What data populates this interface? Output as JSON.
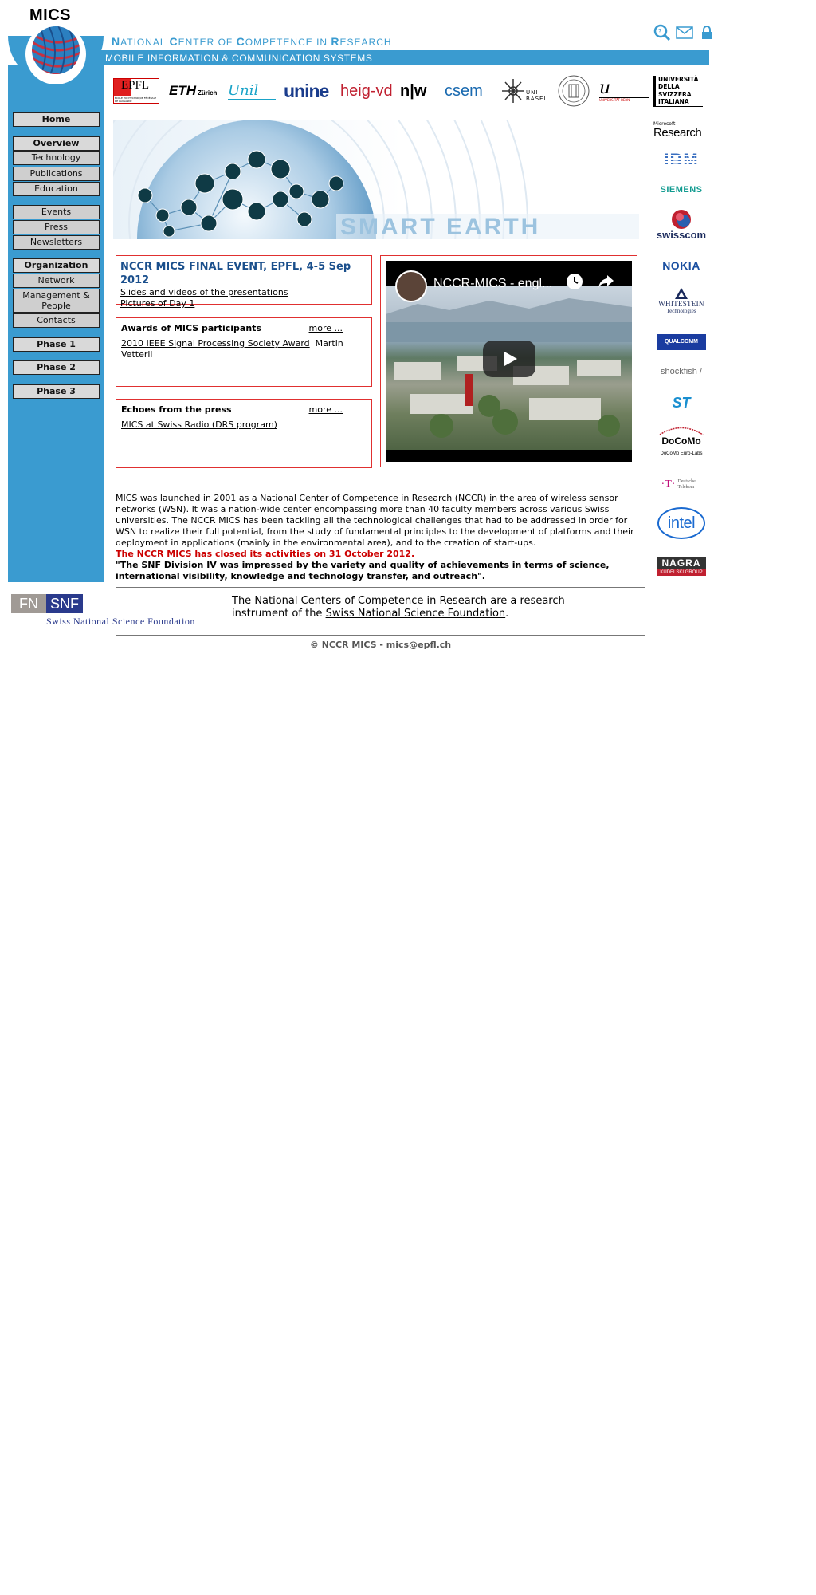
{
  "header": {
    "logo_text": "MICS",
    "nccr_title_parts": [
      {
        "cap": "N",
        "rest": "ATIONAL "
      },
      {
        "cap": "C",
        "rest": "ENTER OF "
      },
      {
        "cap": "C",
        "rest": "OMPETENCE IN "
      },
      {
        "cap": "R",
        "rest": "ESEARCH"
      }
    ],
    "subtitle": "MOBILE INFORMATION & COMMUNICATION SYSTEMS",
    "icons": [
      "search-icon",
      "mail-icon",
      "lock-icon"
    ]
  },
  "sidebar": {
    "items": [
      {
        "label": "Home",
        "bold": true
      },
      {
        "label": "Overview",
        "bold": true
      },
      {
        "label": "Technology"
      },
      {
        "label": "Publications"
      },
      {
        "label": "Education"
      },
      {
        "label": "Events"
      },
      {
        "label": "Press"
      },
      {
        "label": "Newsletters"
      },
      {
        "label": "Organization",
        "bold": true
      },
      {
        "label": "Network"
      },
      {
        "label": "Management & People"
      },
      {
        "label": "Contacts"
      },
      {
        "label": "Phase 1",
        "bold": true
      },
      {
        "label": "Phase 2",
        "bold": true
      },
      {
        "label": "Phase 3",
        "bold": true
      }
    ]
  },
  "partners": {
    "epfl": "EPFL",
    "epfl_sub": "ÉCOLE POLYTECHNIQUE FÉDÉRALE DE LAUSANNE",
    "eth": "ETH",
    "eth_sub": "Zürich",
    "unil": "Unil",
    "unine": "unine",
    "heig": "heig-vd",
    "nw": "n|w",
    "csem": "csem",
    "unibasel": "UNI BASEL",
    "ub": "u",
    "ub_sub": "UNIVERSITÄT BERN",
    "usi": "UNIVERSITÀ DELLA SVIZZERA ITALIANA"
  },
  "banner": {
    "text": "SMART EARTH"
  },
  "event": {
    "title": "NCCR MICS FINAL EVENT, EPFL, 4-5 Sep 2012",
    "link1": "Slides and videos of the presentations",
    "link2": "Pictures of Day 1"
  },
  "awards": {
    "heading": "Awards of MICS participants",
    "more": "more ...",
    "item_link": "2010 IEEE Signal Processing Society Award",
    "item_person": "Martin Vetterli"
  },
  "press": {
    "heading": "Echoes from the press",
    "more": "more ...",
    "item_link": "MICS at Swiss Radio (DRS program)"
  },
  "video": {
    "title": "NCCR-MICS - engl..."
  },
  "description": {
    "text": "MICS was launched in 2001 as a National Center of Competence in Research (NCCR) in the area of wireless sensor networks (WSN). It was a nation-wide center encompassing more than 40 faculty members across various Swiss universities. The NCCR MICS has been tackling all the technological challenges that had to be addressed in order for WSN to realize their full potential, from the study of fundamental principles to the development of platforms and their deployment in applications (mainly in the environmental area), and to the creation of start-ups.",
    "closed": "The NCCR MICS has closed its activities on 31 October 2012.",
    "quote": "\"The SNF Division IV was impressed by the variety and quality of achievements in terms of science, international visibility, knowledge and technology transfer, and outreach\"."
  },
  "snf": {
    "logo_fn": "FN",
    "logo_snf": "SNF",
    "logo_sub": "Swiss National Science Foundation",
    "text_pre": "The ",
    "link1": "National Centers of Competence in Research",
    "text_mid": " are a research instrument of the ",
    "link2": "Swiss National Science Foundation",
    "text_post": "."
  },
  "footer": {
    "copyright": "© NCCR MICS - mics@epfl.ch"
  },
  "sponsors": {
    "msr_small": "Microsoft",
    "msr": "Research",
    "ibm": "IBM",
    "siemens": "SIEMENS",
    "swisscom": "swisscom",
    "nokia": "NOKIA",
    "whitestein": "WHITESTEIN",
    "whitestein_sub": "Technologies",
    "qualcomm": "QUALCOMM",
    "shockfish": "shockfish /",
    "st": "ST",
    "docomo": "DoCoMo",
    "docomo_sub": "DoCoMo Euro-Labs",
    "telekom": "Deutsche Telekom",
    "intel": "intel",
    "nagra": "NAGRA",
    "nagra_sub": "KUDELSKI GROUP"
  },
  "colors": {
    "brand_blue": "#3a9bd0",
    "box_border": "#e03030",
    "event_title": "#1a4f8c",
    "closed_red": "#cc0000"
  }
}
